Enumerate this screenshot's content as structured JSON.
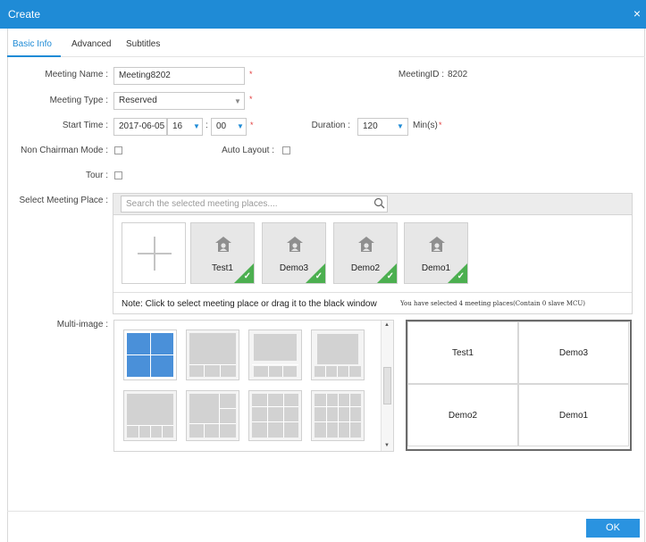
{
  "window": {
    "title": "Create",
    "close": "×"
  },
  "tabs": [
    "Basic Info",
    "Advanced",
    "Subtitles"
  ],
  "form": {
    "meeting_name_label": "Meeting Name :",
    "meeting_name_value": "Meeting8202",
    "meeting_id_label": "MeetingID :",
    "meeting_id_value": "8202",
    "meeting_type_label": "Meeting Type :",
    "meeting_type_value": "Reserved",
    "start_time_label": "Start Time :",
    "start_date": "2017-06-05",
    "start_hour": "16",
    "start_minute": "00",
    "time_sep": ":",
    "duration_label": "Duration :",
    "duration_value": "120",
    "duration_unit": "Min(s)",
    "required_mark": "*",
    "non_chairman_label": "Non Chairman Mode :",
    "auto_layout_label": "Auto Layout :",
    "tour_label": "Tour :"
  },
  "places": {
    "label": "Select Meeting Place :",
    "search_placeholder": "Search the selected meeting places....",
    "selected": [
      "Test1",
      "Demo3",
      "Demo2",
      "Demo1"
    ],
    "note": "Note: Click to select meeting place or drag it to the black window",
    "count_text": "You have selected 4 meeting places(Contain 0 slave MCU)"
  },
  "multi_image": {
    "label": "Multi-image :",
    "preview": [
      "Test1",
      "Demo3",
      "Demo2",
      "Demo1"
    ]
  },
  "footer": {
    "ok": "OK"
  },
  "colors": {
    "accent": "#1f8bd6",
    "check": "#4caf50",
    "layout_selected": "#4a90d9"
  }
}
